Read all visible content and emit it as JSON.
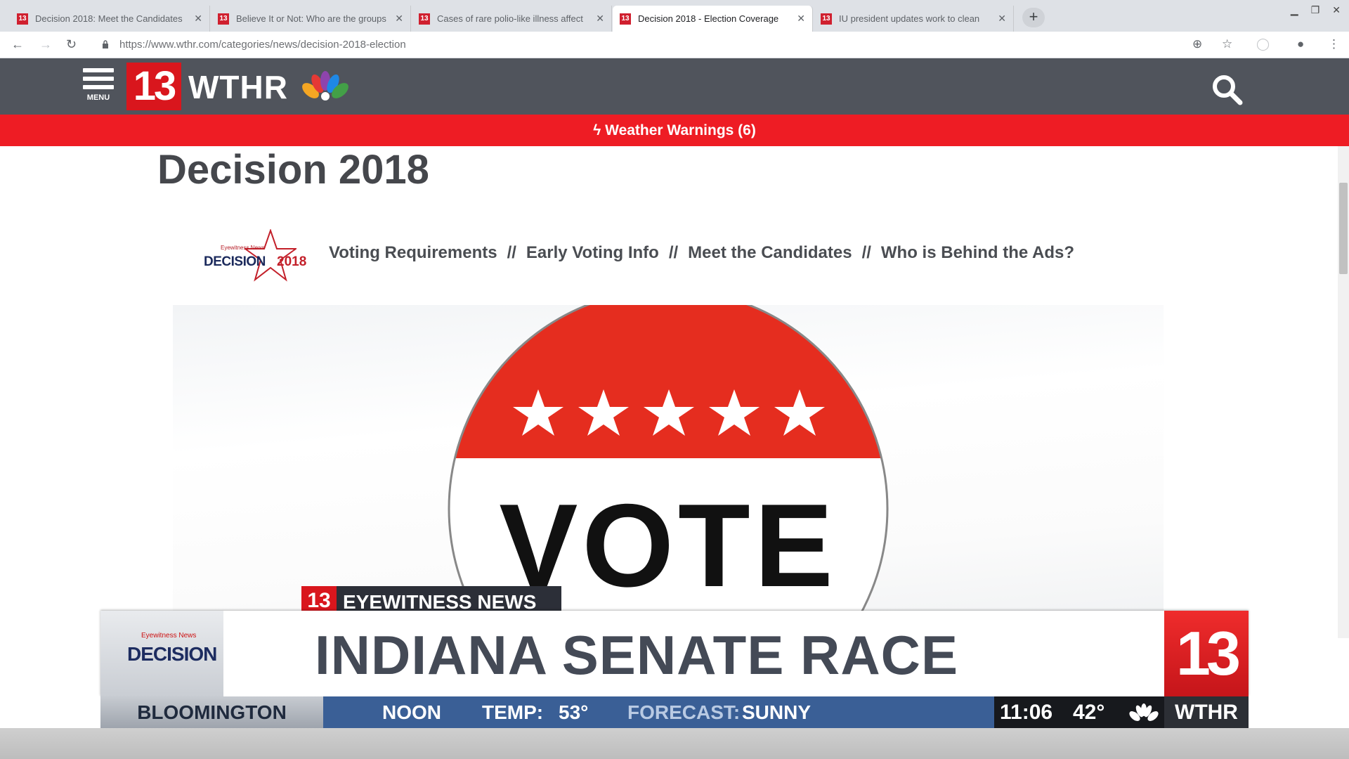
{
  "browser": {
    "tabs": [
      {
        "title": "Decision 2018: Meet the Candidates",
        "active": false
      },
      {
        "title": "Believe It or Not: Who are the groups",
        "active": false
      },
      {
        "title": "Cases of rare polio-like illness affect",
        "active": false
      },
      {
        "title": "Decision 2018 - Election Coverage",
        "active": true
      },
      {
        "title": "IU president updates work to clean",
        "active": false
      }
    ],
    "favicon_label": "13",
    "new_tab_label": "+",
    "address": "https://www.wthr.com/categories/news/decision-2018-election"
  },
  "header": {
    "menu_label": "MENU",
    "logo_number": "13",
    "logo_text": "WTHR",
    "alert": "Weather Warnings (6)"
  },
  "page": {
    "title": "Decision 2018",
    "decision_logo": {
      "small": "Eyewitness News",
      "big": "DECISION",
      "year": "2018"
    },
    "subnav": [
      "Voting Requirements",
      "Early Voting Info",
      "Meet the Candidates",
      "Who is Behind the Ads?"
    ],
    "subnav_separator": "//",
    "hero": {
      "button_text": "VOTE",
      "banner_text": "EYEWITNESS NEWS",
      "banner_number": "13"
    }
  },
  "broadcast": {
    "logo_small": "Eyewitness News",
    "logo_big": "DECISION",
    "headline": "INDIANA SENATE RACE",
    "channel_number": "13",
    "location": "BLOOMINGTON",
    "show": "NOON",
    "temp_label": "TEMP:",
    "temp_value": "53°",
    "forecast_label": "FORECAST:",
    "forecast_value": "SUNNY",
    "time": "11:06",
    "current_temp": "42°",
    "brand": "WTHR"
  },
  "colors": {
    "brand_red": "#d9161d",
    "alert_red": "#ee1c24",
    "header_gray": "#50545c",
    "ticker_blue": "#3a5f96"
  }
}
